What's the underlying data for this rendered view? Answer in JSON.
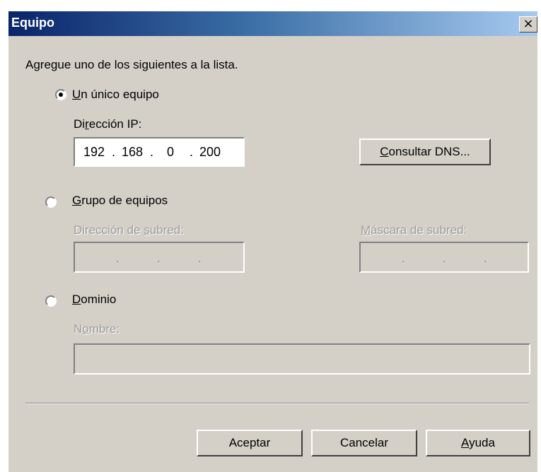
{
  "window": {
    "title": "Equipo",
    "close_glyph": "×",
    "close_icon": "close-icon"
  },
  "instruction": "Agregue uno de los siguientes a la lista.",
  "options": {
    "single": {
      "label": "Un único equipo",
      "mnemonic": "U",
      "selected": true
    },
    "group": {
      "label": "Grupo de equipos",
      "mnemonic": "G",
      "selected": false
    },
    "domain": {
      "label": "Dominio",
      "mnemonic": "D",
      "selected": false
    }
  },
  "single": {
    "ip_label": "Dirección IP:",
    "ip": [
      "192",
      "168",
      "0",
      "200"
    ],
    "dns_button": "Consultar DNS..."
  },
  "group": {
    "subnet_label": "Dirección de subred:",
    "mask_label": "Máscara de subred:"
  },
  "domain_opt": {
    "name_label": "Nombre:"
  },
  "buttons": {
    "ok": "Aceptar",
    "cancel": "Cancelar",
    "help": "Ayuda"
  }
}
